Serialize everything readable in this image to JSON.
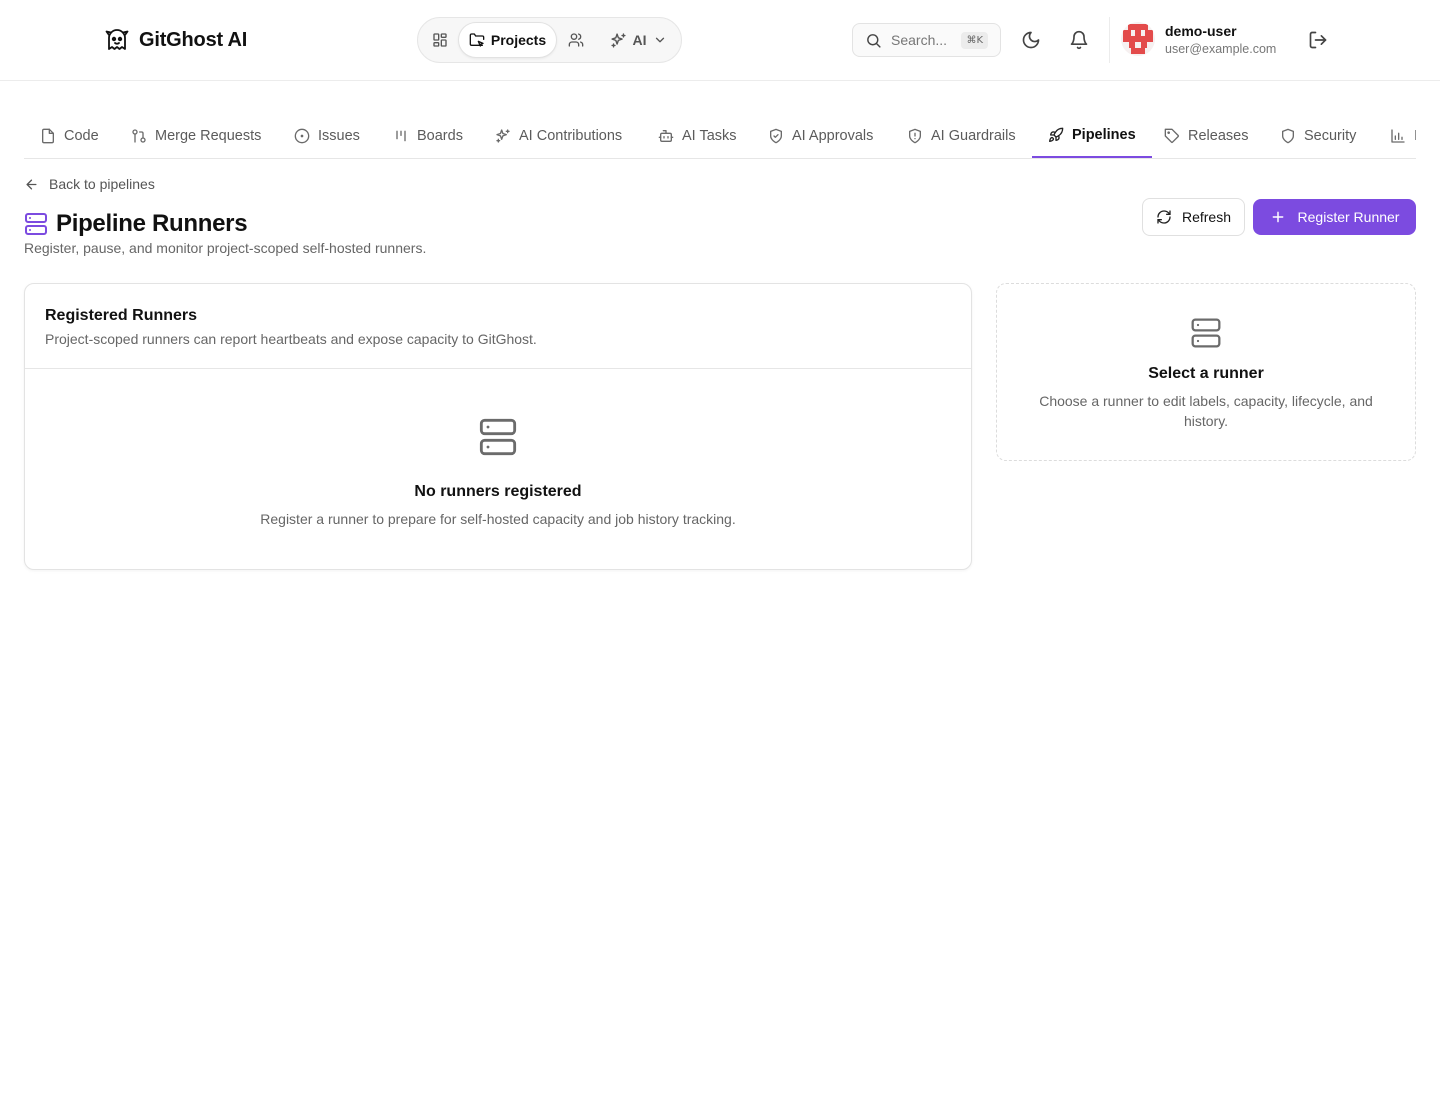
{
  "app": {
    "brand_name": "GitGhost AI"
  },
  "topnav": {
    "projects_label": "Projects",
    "ai_label": "AI"
  },
  "search": {
    "placeholder": "Search...",
    "shortcut": "⌘K"
  },
  "user": {
    "name": "demo-user",
    "email": "user@example.com"
  },
  "tabs": [
    {
      "label": "Code",
      "icon": "file-icon"
    },
    {
      "label": "Merge Requests",
      "icon": "git-merge-icon"
    },
    {
      "label": "Issues",
      "icon": "circle-dot-icon"
    },
    {
      "label": "Boards",
      "icon": "kanban-icon"
    },
    {
      "label": "AI Contributions",
      "icon": "sparkles-icon"
    },
    {
      "label": "AI Tasks",
      "icon": "bot-icon"
    },
    {
      "label": "AI Approvals",
      "icon": "shield-check-icon"
    },
    {
      "label": "AI Guardrails",
      "icon": "shield-alert-icon"
    },
    {
      "label": "Pipelines",
      "icon": "rocket-icon",
      "active": true
    },
    {
      "label": "Releases",
      "icon": "tag-icon"
    },
    {
      "label": "Security",
      "icon": "shield-icon"
    },
    {
      "label": "I",
      "icon": "bar-chart-icon"
    }
  ],
  "page": {
    "back_label": "Back to pipelines",
    "title": "Pipeline Runners",
    "subtitle": "Register, pause, and monitor project-scoped self-hosted runners.",
    "refresh_label": "Refresh",
    "register_label": "Register Runner"
  },
  "runners_card": {
    "title": "Registered Runners",
    "description": "Project-scoped runners can report heartbeats and expose capacity to GitGhost.",
    "empty_title": "No runners registered",
    "empty_description": "Register a runner to prepare for self-hosted capacity and job history tracking."
  },
  "detail_card": {
    "title": "Select a runner",
    "description": "Choose a runner to edit labels, capacity, lifecycle, and history."
  },
  "colors": {
    "accent": "#7c4be0",
    "text": "#111111",
    "muted": "#666666",
    "border": "#e3e3e3"
  }
}
